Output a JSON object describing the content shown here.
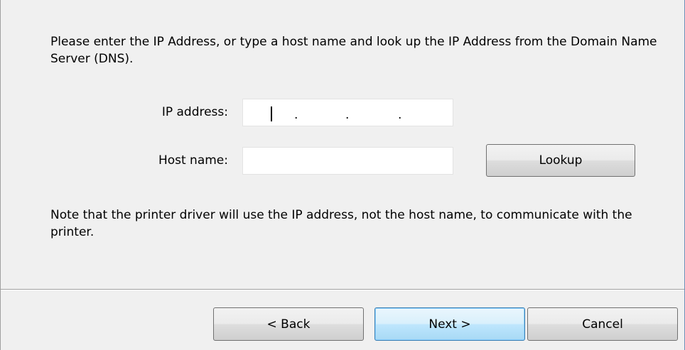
{
  "intro_text": "Please enter the IP Address, or type a host name and look up the IP Address from the Domain Name Server (DNS).",
  "ip_field": {
    "label": "IP address:",
    "value": "",
    "separator": "."
  },
  "host_field": {
    "label": "Host name:",
    "value": ""
  },
  "lookup_label": "Lookup",
  "note_text": "Note that the printer driver will use the IP address, not the host name, to communicate with the printer.",
  "buttons": {
    "back": "< Back",
    "next": "Next >",
    "cancel": "Cancel"
  },
  "colors": {
    "background": "#f0f0f0",
    "default_button_border": "#3c7fb1"
  }
}
